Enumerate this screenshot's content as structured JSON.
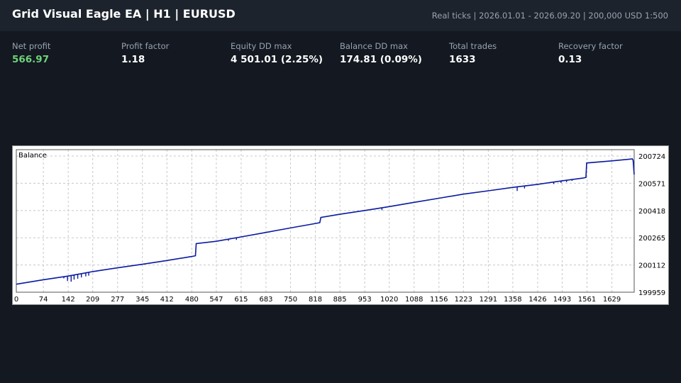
{
  "header": {
    "title": "Grid Visual Eagle EA  |  H1  |  EURUSD",
    "meta": "Real ticks  |  2026.01.01 - 2026.09.20  |  200,000 USD  1:500"
  },
  "stats": [
    {
      "label": "Net profit",
      "value": "566.97",
      "color": "#6fd27a"
    },
    {
      "label": "Profit factor",
      "value": "1.18"
    },
    {
      "label": "Equity DD max",
      "value": "4 501.01 (2.25%)"
    },
    {
      "label": "Balance DD max",
      "value": "174.81 (0.09%)"
    },
    {
      "label": "Total trades",
      "value": "1633"
    },
    {
      "label": "Recovery factor",
      "value": "0.13"
    }
  ],
  "chart_data": {
    "type": "line",
    "title": "Balance",
    "series_color": "#0a1aa0",
    "grid": true,
    "xlim": [
      0,
      1690
    ],
    "ylim": [
      199959,
      200760
    ],
    "x_ticks": [
      "0",
      "74",
      "142",
      "209",
      "277",
      "345",
      "412",
      "480",
      "547",
      "615",
      "683",
      "750",
      "818",
      "885",
      "953",
      "1020",
      "1088",
      "1156",
      "1223",
      "1291",
      "1358",
      "1426",
      "1493",
      "1561",
      "1629"
    ],
    "y_ticks": [
      "199959",
      "200112",
      "200265",
      "200418",
      "200571",
      "200724"
    ],
    "points": [
      [
        0,
        200004
      ],
      [
        74,
        200029
      ],
      [
        142,
        200050
      ],
      [
        209,
        200075
      ],
      [
        277,
        200096
      ],
      [
        345,
        200116
      ],
      [
        412,
        200137
      ],
      [
        480,
        200160
      ],
      [
        490,
        200164
      ],
      [
        492,
        200232
      ],
      [
        547,
        200245
      ],
      [
        615,
        200270
      ],
      [
        683,
        200295
      ],
      [
        750,
        200320
      ],
      [
        818,
        200345
      ],
      [
        830,
        200350
      ],
      [
        833,
        200379
      ],
      [
        885,
        200397
      ],
      [
        953,
        200418
      ],
      [
        1020,
        200440
      ],
      [
        1088,
        200464
      ],
      [
        1156,
        200487
      ],
      [
        1223,
        200510
      ],
      [
        1291,
        200529
      ],
      [
        1358,
        200548
      ],
      [
        1426,
        200565
      ],
      [
        1493,
        200585
      ],
      [
        1550,
        200600
      ],
      [
        1558,
        200604
      ],
      [
        1560,
        200685
      ],
      [
        1629,
        200697
      ],
      [
        1685,
        200708
      ],
      [
        1687,
        200700
      ],
      [
        1690,
        200620
      ]
    ],
    "spikes": [
      [
        130,
        200037
      ],
      [
        140,
        200022
      ],
      [
        150,
        200018
      ],
      [
        158,
        200030
      ],
      [
        168,
        200035
      ],
      [
        178,
        200042
      ],
      [
        190,
        200048
      ],
      [
        198,
        200052
      ],
      [
        455,
        200153
      ],
      [
        470,
        200157
      ],
      [
        580,
        200248
      ],
      [
        602,
        200253
      ],
      [
        1000,
        200420
      ],
      [
        1370,
        200528
      ],
      [
        1390,
        200542
      ],
      [
        1470,
        200567
      ],
      [
        1490,
        200573
      ],
      [
        1505,
        200578
      ],
      [
        1520,
        200585
      ]
    ]
  }
}
